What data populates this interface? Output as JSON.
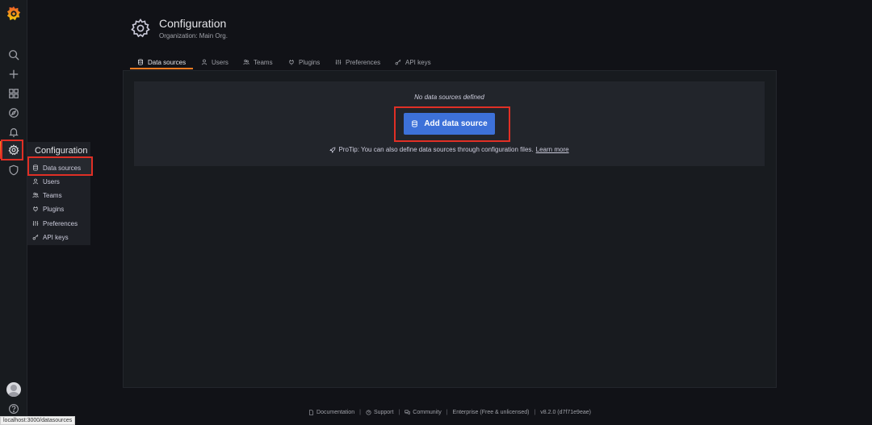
{
  "sidebar": {
    "items": [
      "search-icon",
      "plus-icon",
      "dashboards-icon",
      "explore-icon",
      "alerting-icon",
      "configuration-icon",
      "shield-icon"
    ],
    "bottom": [
      "avatar",
      "help-icon"
    ]
  },
  "flyout": {
    "title": "Configuration",
    "items": [
      {
        "label": "Data sources",
        "icon": "database-icon"
      },
      {
        "label": "Users",
        "icon": "user-icon"
      },
      {
        "label": "Teams",
        "icon": "users-icon"
      },
      {
        "label": "Plugins",
        "icon": "plug-icon"
      },
      {
        "label": "Preferences",
        "icon": "sliders-icon"
      },
      {
        "label": "API keys",
        "icon": "key-icon"
      }
    ]
  },
  "header": {
    "title": "Configuration",
    "subtitle": "Organization: Main Org."
  },
  "tabs": [
    {
      "label": "Data sources",
      "active": true
    },
    {
      "label": "Users"
    },
    {
      "label": "Teams"
    },
    {
      "label": "Plugins"
    },
    {
      "label": "Preferences"
    },
    {
      "label": "API keys"
    }
  ],
  "empty_state": {
    "title": "No data sources defined",
    "button_label": "Add data source",
    "protip_text": "ProTip: You can also define data sources through configuration files.",
    "learn_more": "Learn more"
  },
  "footer": {
    "documentation": "Documentation",
    "support": "Support",
    "community": "Community",
    "edition": "Enterprise (Free & unlicensed)",
    "version": "v8.2.0 (d7f71e9eae)"
  },
  "status_url": "localhost:3000/datasources",
  "colors": {
    "accent_blue": "#3d71d9",
    "highlight_red": "#e02f25",
    "tab_orange": "#f47a20"
  }
}
